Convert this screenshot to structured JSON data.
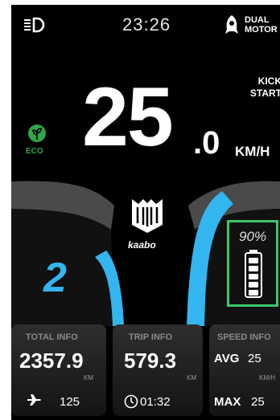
{
  "status_bar": {
    "time": "23:26",
    "motor_mode_line1": "DUAL",
    "motor_mode_line2": "MOTOR"
  },
  "kick_start": {
    "line1": "KICK",
    "line2": "START"
  },
  "speed": {
    "integer": "25",
    "decimal": ".0",
    "unit": "KM/H"
  },
  "ride_mode": {
    "label": "ECO"
  },
  "gear": "2",
  "brand": "kaabo",
  "battery": {
    "percent_label": "90%",
    "level": 0.9
  },
  "cards": {
    "total": {
      "title": "TOTAL INFO",
      "value": "2357.9",
      "unit": "KM",
      "secondary": "125"
    },
    "trip": {
      "title": "TRIP INFO",
      "value": "579.3",
      "unit": "KM",
      "duration": "01:32"
    },
    "speed_info": {
      "title": "SPEED INFO",
      "avg_label": "AVG",
      "avg_value": "25",
      "unit": "KM/H",
      "max_label": "MAX",
      "max_value": "25"
    }
  },
  "colors": {
    "accent_blue": "#33b5f0",
    "eco_green": "#2fa64a",
    "battery_highlight": "#3cc86a"
  },
  "icons": [
    "headlight-icon",
    "motor-icon",
    "eco-leaf-icon",
    "battery-icon",
    "plane-icon",
    "clock-icon"
  ]
}
